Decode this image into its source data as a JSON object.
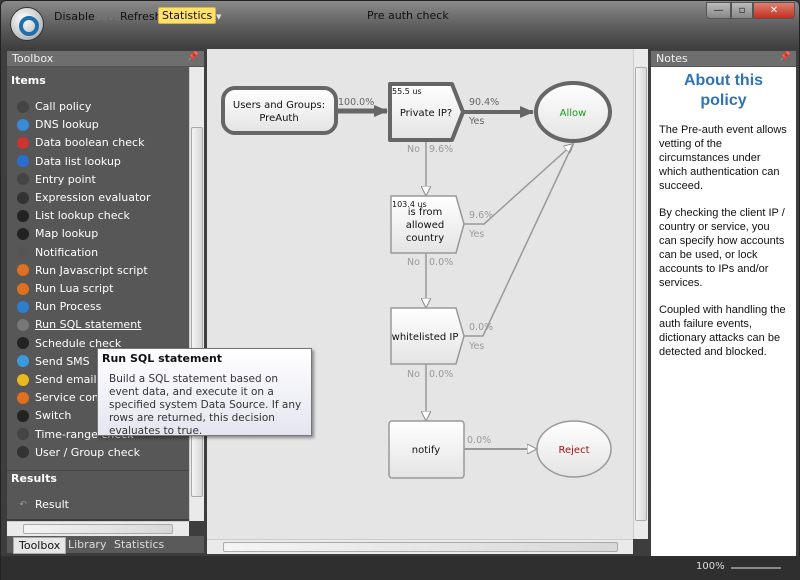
{
  "toolbar": {
    "disable": "Disable",
    "save": "Save",
    "refresh": "Refresh",
    "statistics": "Statistics",
    "more": "▾"
  },
  "window": {
    "title": "Pre auth check",
    "minimize": "—",
    "maximize": "▫",
    "close": "✕"
  },
  "toolbox": {
    "title": "Toolbox",
    "items_header": "Items",
    "results_header": "Results",
    "items": [
      {
        "label": "Call policy",
        "icon": "circle-icon"
      },
      {
        "label": "DNS lookup",
        "icon": "globe-search-icon"
      },
      {
        "label": "Data boolean check",
        "icon": "yes-no-icon"
      },
      {
        "label": "Data list lookup",
        "icon": "globe-icon"
      },
      {
        "label": "Entry point",
        "icon": "circle-icon"
      },
      {
        "label": "Expression evaluator",
        "icon": "pencil-icon"
      },
      {
        "label": "List lookup check",
        "icon": "list-icon"
      },
      {
        "label": "Map lookup",
        "icon": "list-icon"
      },
      {
        "label": "Notification",
        "icon": "exclamation-icon"
      },
      {
        "label": "Run Javascript script",
        "icon": "gear-icon"
      },
      {
        "label": "Run Lua script",
        "icon": "gear-icon"
      },
      {
        "label": "Run Process",
        "icon": "window-icon"
      },
      {
        "label": "Run SQL statement",
        "icon": "database-icon"
      },
      {
        "label": "Schedule check",
        "icon": "calendar-icon"
      },
      {
        "label": "Send SMS",
        "icon": "phone-icon"
      },
      {
        "label": "Send email",
        "icon": "envelope-icon"
      },
      {
        "label": "Service control",
        "icon": "gears-icon"
      },
      {
        "label": "Switch",
        "icon": "switch-icon"
      },
      {
        "label": "Time-range check",
        "icon": "clock-icon"
      },
      {
        "label": "User / Group check",
        "icon": "user-icon"
      }
    ],
    "results": [
      {
        "label": "Result",
        "icon": "undo-icon"
      }
    ],
    "tabs": [
      "Toolbox",
      "Library",
      "Statistics"
    ]
  },
  "tooltip": {
    "title": "Run SQL statement",
    "body": "Build a SQL statement based on event data, and execute it on a specified system Data Source.  If any rows are returned, this decision evaluates to true."
  },
  "diagram": {
    "nodes": {
      "start": [
        "Users and Groups:",
        "PreAuth"
      ],
      "private_ip": "Private IP?",
      "private_ip_time": "55.5 us",
      "country": [
        "is from",
        "allowed",
        "country"
      ],
      "country_time": "103.4 us",
      "whitelisted": "whitelisted IP",
      "notify": "notify",
      "allow": "Allow",
      "reject": "Reject"
    },
    "edges": {
      "start_pct": "100.0%",
      "pip_yes_pct": "90.4%",
      "pip_yes": "Yes",
      "pip_no": "No",
      "pip_no_pct": "9.6%",
      "c_yes_pct": "9.6%",
      "c_yes": "Yes",
      "c_no": "No",
      "c_no_pct": "0.0%",
      "w_yes_pct": "0.0%",
      "w_yes": "Yes",
      "w_no": "No",
      "w_no_pct": "0.0%",
      "notify_pct": "0.0%"
    },
    "colors": {
      "allow": "#1a9a1a",
      "reject": "#a01010"
    }
  },
  "notes": {
    "title": "Notes",
    "heading": "About this policy",
    "paragraphs": [
      "The Pre-auth event allows vetting of the circumstances under which authentication can succeed.",
      "By checking the client IP / country or service, you can specify how accounts can be used, or lock accounts to IPs and/or services.",
      "Coupled with handling the auth failure events, dictionary attacks can be detected and blocked."
    ]
  },
  "status": {
    "zoom": "100%"
  }
}
